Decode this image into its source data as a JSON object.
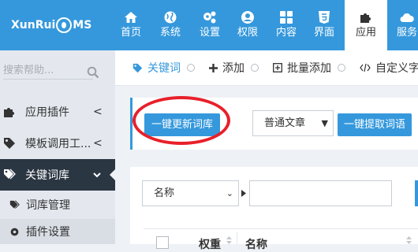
{
  "app": {
    "logo_text_left": "XunRui",
    "logo_text_right": "MS"
  },
  "topnav": [
    {
      "label": "首页",
      "icon": "home-icon"
    },
    {
      "label": "系统",
      "icon": "globe-icon"
    },
    {
      "label": "设置",
      "icon": "gears-icon"
    },
    {
      "label": "权限",
      "icon": "user-circle-icon"
    },
    {
      "label": "内容",
      "icon": "grid-icon"
    },
    {
      "label": "界面",
      "icon": "html5-icon"
    },
    {
      "label": "应用",
      "icon": "puzzle-icon",
      "active": true
    },
    {
      "label": "服务",
      "icon": "cloud-icon"
    }
  ],
  "sidebar": {
    "search_placeholder": "搜索帮助...",
    "items": [
      {
        "label": "应用插件",
        "icon": "puzzle-icon",
        "chevron": "<"
      },
      {
        "label": "模板调用工...",
        "icon": "tag-icon",
        "chevron": "<"
      },
      {
        "label": "关键词库",
        "icon": "tags-icon",
        "chevron": "v",
        "active": true
      }
    ],
    "subitems": [
      {
        "label": "词库管理",
        "icon": "tags-icon"
      },
      {
        "label": "插件设置",
        "icon": "gear-icon"
      }
    ]
  },
  "breadcrumb": [
    {
      "label": "关键词",
      "icon": "tag-icon"
    },
    {
      "label": "添加",
      "icon": "plus-icon"
    },
    {
      "label": "批量添加",
      "icon": "plus-square-icon"
    },
    {
      "label": "自定义字段",
      "icon": "code-icon"
    }
  ],
  "toolbar": {
    "update_button": "一键更新词库",
    "article_select": "普通文章",
    "extract_button": "一键提取词语"
  },
  "filter": {
    "field_select": "名称"
  },
  "table": {
    "headers": [
      "权重",
      "名称"
    ]
  },
  "colors": {
    "accent": "#3598dc",
    "sidebar_active": "#2b3643",
    "highlight": "#e8202a"
  }
}
